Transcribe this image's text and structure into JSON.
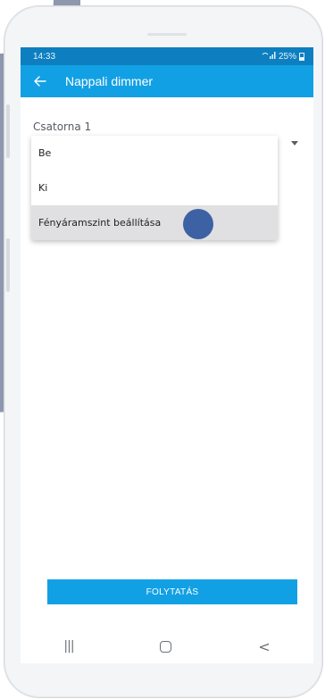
{
  "status": {
    "time": "14:33",
    "battery": "25%",
    "signal_icon": "wifi-signal-icon"
  },
  "appbar": {
    "title": "Nappali dimmer",
    "back_icon": "arrow-left-icon"
  },
  "form": {
    "channel_label": "Csatorna 1"
  },
  "dropdown": {
    "options": [
      {
        "label": "Be"
      },
      {
        "label": "Ki"
      },
      {
        "label": "Fényáramszint beállítása",
        "highlighted": true
      }
    ]
  },
  "actions": {
    "continue_label": "FOLYTATÁS"
  },
  "colors": {
    "status_bar": "#0d7fc0",
    "app_bar": "#12a0e4",
    "touch_indicator": "#3d62a3"
  },
  "navbar": {
    "recents": "|||",
    "back": "<"
  }
}
